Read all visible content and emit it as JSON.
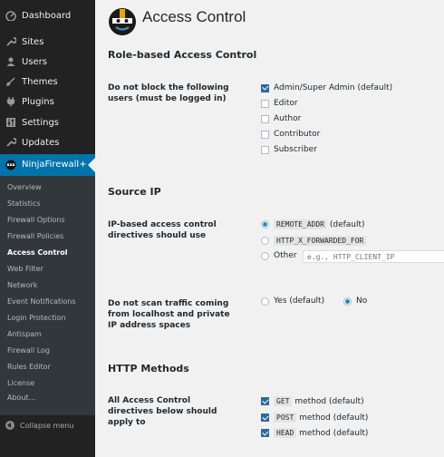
{
  "sidebar": {
    "items": [
      {
        "label": "Dashboard",
        "icon": "dashboard-icon"
      },
      {
        "label": "Sites",
        "icon": "wrench-icon"
      },
      {
        "label": "Users",
        "icon": "users-icon"
      },
      {
        "label": "Themes",
        "icon": "brush-icon"
      },
      {
        "label": "Plugins",
        "icon": "plug-icon"
      },
      {
        "label": "Settings",
        "icon": "settings-icon"
      },
      {
        "label": "Updates",
        "icon": "wrench-icon"
      }
    ],
    "active": {
      "label": "NinjaFirewall+",
      "icon": "ninja-icon"
    },
    "submenu": [
      "Overview",
      "Statistics",
      "Firewall Options",
      "Firewall Policies",
      "Access Control",
      "Web Filter",
      "Network",
      "Event Notifications",
      "Login Protection",
      "Antispam",
      "Firewall Log",
      "Rules Editor",
      "License",
      "About..."
    ],
    "current_sub": "Access Control",
    "collapse_label": "Collapse menu"
  },
  "page": {
    "title": "Access Control",
    "sections": {
      "role": {
        "title": "Role-based Access Control",
        "label": "Do not block the following users (must be logged in)",
        "options": [
          {
            "label": "Admin/Super Admin (default)",
            "checked": true
          },
          {
            "label": "Editor",
            "checked": false
          },
          {
            "label": "Author",
            "checked": false
          },
          {
            "label": "Contributor",
            "checked": false
          },
          {
            "label": "Subscriber",
            "checked": false
          }
        ]
      },
      "source_ip": {
        "title": "Source IP",
        "label": "IP-based access control directives should use",
        "options": [
          {
            "code": "REMOTE_ADDR",
            "suffix": "(default)",
            "checked": true
          },
          {
            "code": "HTTP_X_FORWARDED_FOR",
            "suffix": "",
            "checked": false
          },
          {
            "code": "",
            "suffix": "Other",
            "checked": false
          }
        ],
        "other_placeholder": "e.g., HTTP_CLIENT_IP",
        "localhost_label": "Do not scan traffic coming from localhost and private IP address spaces",
        "localhost_options": [
          {
            "label": "Yes (default)",
            "checked": false
          },
          {
            "label": "No",
            "checked": true
          }
        ]
      },
      "http_methods": {
        "title": "HTTP Methods",
        "label": "All Access Control directives below should apply to",
        "options": [
          {
            "code": "GET",
            "suffix": "method (default)",
            "checked": true
          },
          {
            "code": "POST",
            "suffix": "method (default)",
            "checked": true
          },
          {
            "code": "HEAD",
            "suffix": "method (default)",
            "checked": true
          }
        ]
      }
    }
  }
}
